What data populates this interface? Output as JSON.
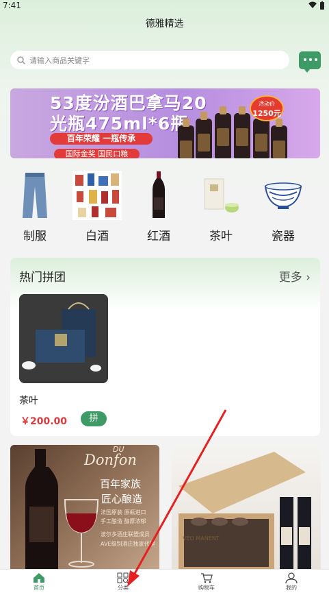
{
  "status_bar": {
    "time": "7:41"
  },
  "header": {
    "title": "德雅精选"
  },
  "search": {
    "placeholder": "请输入商品关键字"
  },
  "banner": {
    "line1": "53度汾酒巴拿马20",
    "line2": "光瓶475ml*6瓶",
    "tag1": "百年荣耀 一瓶传承",
    "tag2": "国际金奖 国民口粮",
    "badge_top": "活动价",
    "badge_price": "1250元"
  },
  "categories": [
    {
      "label": "制服",
      "icon": "jeans-icon"
    },
    {
      "label": "白酒",
      "icon": "baijiu-icon"
    },
    {
      "label": "红酒",
      "icon": "red-wine-icon"
    },
    {
      "label": "茶叶",
      "icon": "tea-icon"
    },
    {
      "label": "瓷器",
      "icon": "porcelain-icon"
    }
  ],
  "group_buy": {
    "title": "热门拼团",
    "more": "更多",
    "product": {
      "name": "茶叶",
      "price": "￥200.00",
      "badge": "拼"
    }
  },
  "promo_left": {
    "brand_small": "DU",
    "brand": "Donfon",
    "slogan1": "百年家族",
    "slogan2": "匠心酿造",
    "line1": "法国原装 原瓶进口",
    "line2": "手工酿造 醇厚浓郁",
    "line3": "波尔多酒庄联盟成员",
    "line4": "AVE级别酒庄独家代理"
  },
  "promo_right": {
    "brand": "VEO MANENT"
  },
  "tabbar": {
    "items": [
      {
        "label": "首页",
        "icon": "home-icon",
        "active": true
      },
      {
        "label": "分类",
        "icon": "grid-search-icon",
        "active": false
      },
      {
        "label": "购物车",
        "icon": "cart-icon",
        "active": false
      },
      {
        "label": "我的",
        "icon": "user-icon",
        "active": false
      }
    ]
  },
  "colors": {
    "accent": "#3e9a66",
    "price": "#e03a3a",
    "banner": "#b68ee0"
  }
}
